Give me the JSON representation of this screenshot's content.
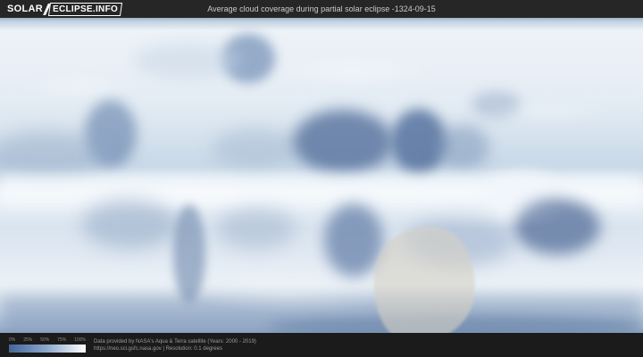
{
  "header": {
    "logo": {
      "primary": "SOLAR",
      "secondary": "ECLIPSE.INFO"
    },
    "title": "Average cloud coverage during partial solar eclipse -1324-09-15"
  },
  "footer": {
    "legend": {
      "ticks": [
        "0%",
        "25%",
        "50%",
        "75%",
        "100%"
      ],
      "min_color": "#44659a",
      "max_color": "#ffffff"
    },
    "attribution_line1": "Data provided by NASA's Aqua & Terra satellite (Years: 2000 - 2019)",
    "attribution_line2": "https://neo.sci.gsfc.nasa.gov | Resolution: 0.1 degrees"
  },
  "colors": {
    "header_bg": "#262626",
    "footer_bg": "#1b1b1b",
    "clear_sky_blue": "#56709c",
    "cloudy_white": "#f4f8fb",
    "eclipse_shade": "#d5d0c5"
  }
}
